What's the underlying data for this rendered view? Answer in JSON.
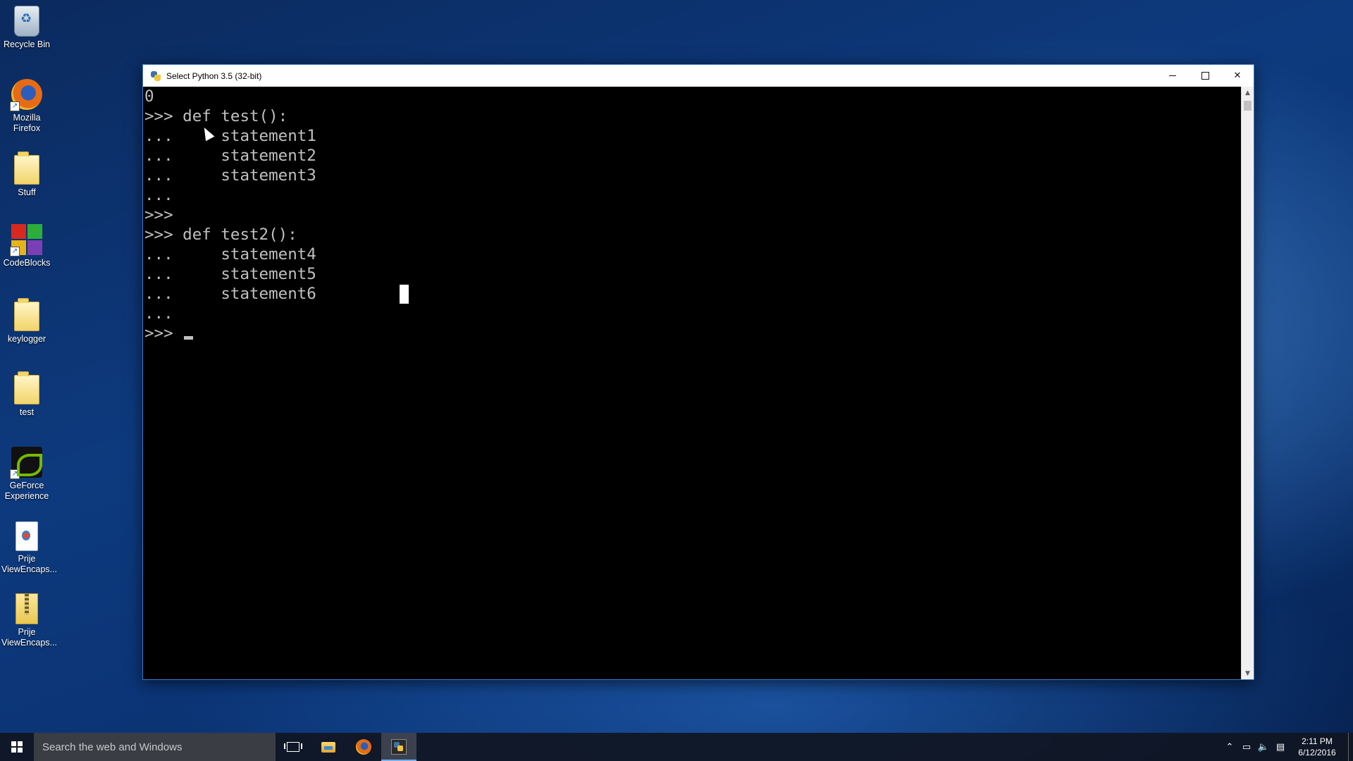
{
  "desktop": {
    "icons": [
      {
        "label": "Recycle Bin"
      },
      {
        "label": "Mozilla Firefox"
      },
      {
        "label": "Stuff"
      },
      {
        "label": "CodeBlocks"
      },
      {
        "label": "keylogger"
      },
      {
        "label": "test"
      },
      {
        "label": "GeForce Experience"
      },
      {
        "label": "Prije ViewEncaps..."
      },
      {
        "label": "Prije ViewEncaps..."
      }
    ]
  },
  "window": {
    "title": "Select Python 3.5 (32-bit)"
  },
  "terminal": {
    "lines": [
      "0",
      ">>> def test():",
      "...     statement1",
      "...     statement2",
      "...     statement3",
      "...",
      ">>>",
      ">>> def test2():",
      "...     statement4",
      "...     statement5",
      "...     statement6",
      "...",
      ">>> "
    ]
  },
  "taskbar": {
    "search_placeholder": "Search the web and Windows",
    "clock_time": "2:11 PM",
    "clock_date": "6/12/2016"
  },
  "colors": {
    "terminal_bg": "#000000",
    "terminal_fg": "#c0c0c0",
    "window_border": "#3b78c8",
    "taskbar_bg": "#101622"
  },
  "icons": {
    "start": "windows-logo-icon",
    "task_view": "task-view-icon",
    "file_explorer": "folder-icon",
    "firefox": "firefox-icon",
    "python": "python-icon"
  }
}
